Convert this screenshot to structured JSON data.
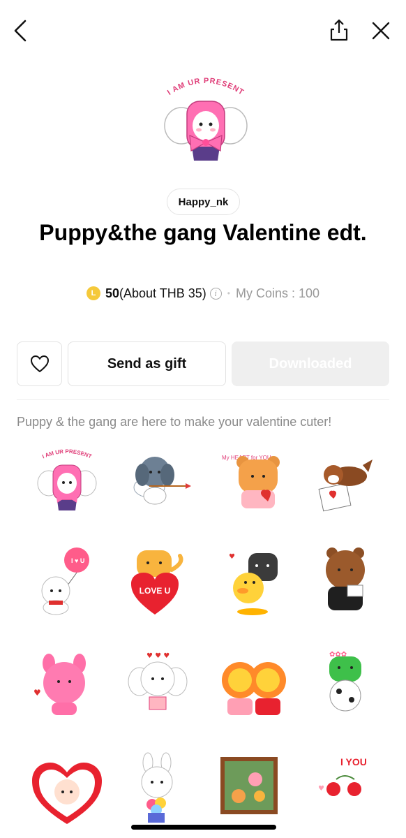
{
  "header": {
    "back_icon": "chevron-left-icon",
    "share_icon": "share-icon",
    "close_icon": "close-icon"
  },
  "hero": {
    "caption": "I AM UR PRESENT"
  },
  "product": {
    "author": "Happy_nk",
    "title": "Puppy&the gang Valentine edt.",
    "coin_symbol": "L",
    "price": "50",
    "price_note": "(About THB 35)",
    "info_symbol": "i",
    "separator": "•",
    "my_coins": "My Coins : 100",
    "description": "Puppy & the gang are here to make your valentine cuter!"
  },
  "actions": {
    "favorite_icon": "heart-outline-icon",
    "gift_label": "Send as gift",
    "download_label": "Downloaded"
  },
  "stickers": [
    {
      "text": "I AM UR PRESENT"
    },
    {
      "text": ""
    },
    {
      "text": "My HEART for YOU"
    },
    {
      "text": ""
    },
    {
      "text": "I ♥ U"
    },
    {
      "text": "LOVE U"
    },
    {
      "text": ""
    },
    {
      "text": ""
    },
    {
      "text": ""
    },
    {
      "text": ""
    },
    {
      "text": ""
    },
    {
      "text": ""
    },
    {
      "text": ""
    },
    {
      "text": ""
    },
    {
      "text": ""
    },
    {
      "text": "I YOU"
    }
  ],
  "colors": {
    "coin": "#f5c93a",
    "title": "#000000",
    "muted": "#8a8a8a",
    "disabled_button": "#efefef",
    "border": "#e2e2e2"
  }
}
